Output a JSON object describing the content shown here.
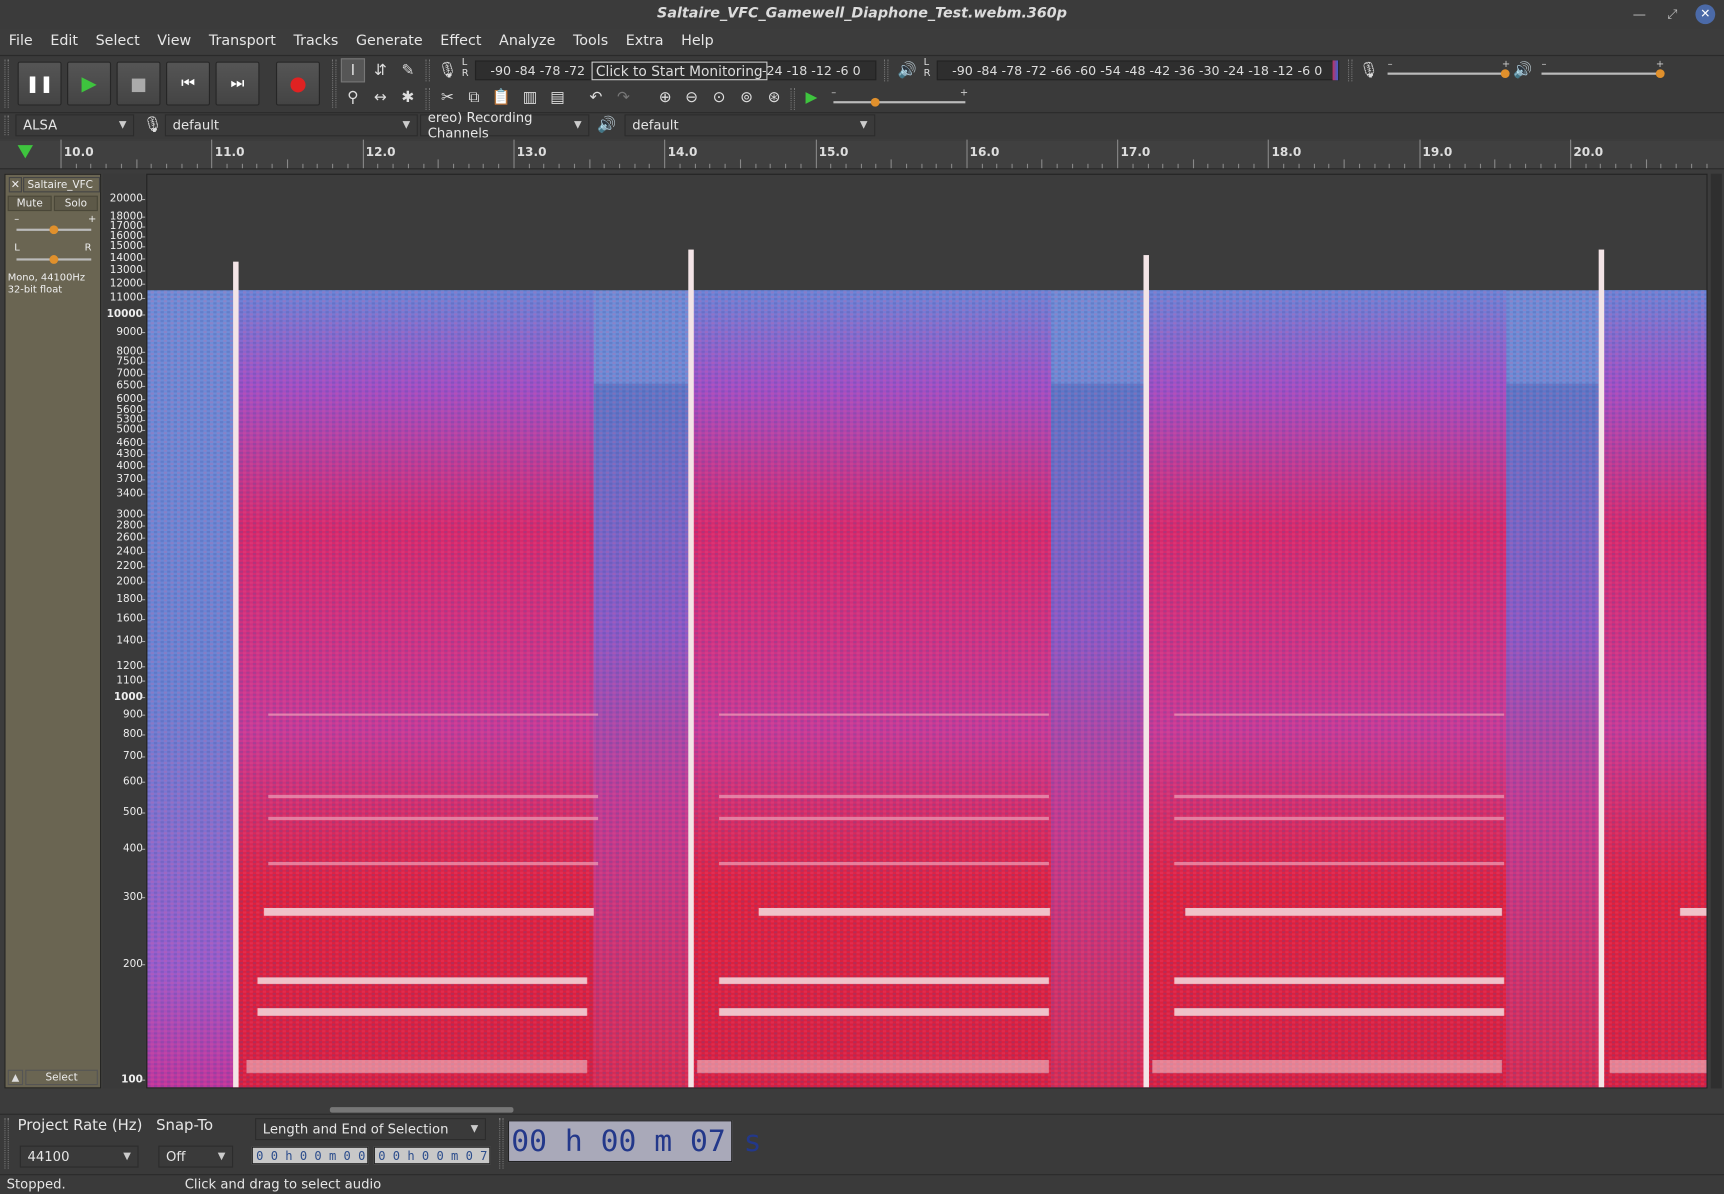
{
  "window": {
    "title": "Saltaire_VFC_Gamewell_Diaphone_Test.webm.360p"
  },
  "menu": [
    "File",
    "Edit",
    "Select",
    "View",
    "Transport",
    "Tracks",
    "Generate",
    "Effect",
    "Analyze",
    "Tools",
    "Extra",
    "Help"
  ],
  "meters": {
    "record_scale": "-90 -84 -78 -72",
    "record_tail": "-24 -18 -12  -6  0",
    "monitor_prompt": "Click to Start Monitoring",
    "playback_scale": "-90 -84 -78 -72 -66 -60 -54 -48 -42 -36 -30 -24 -18 -12  -6  0",
    "L": "L",
    "R": "R"
  },
  "devices": {
    "host": "ALSA",
    "recording_device": "default",
    "recording_channels": "ereo) Recording Channels",
    "playback_device": "default"
  },
  "ruler": {
    "labels": [
      "10.0",
      "11.0",
      "12.0",
      "13.0",
      "14.0",
      "15.0",
      "16.0",
      "17.0",
      "18.0",
      "19.0",
      "20.0"
    ]
  },
  "track": {
    "name": "Saltaire_VFC",
    "mute": "Mute",
    "solo": "Solo",
    "gain_minus": "–",
    "gain_plus": "+",
    "pan_left": "L",
    "pan_right": "R",
    "info_line1": "Mono, 44100Hz",
    "info_line2": "32-bit float",
    "select": "Select",
    "collapse": "▲",
    "close": "✕"
  },
  "freq_scale": [
    "20000",
    "18000",
    "17000",
    "16000",
    "15000",
    "14000",
    "13000",
    "12000",
    "11000",
    "10000",
    "9000",
    "8000",
    "7500",
    "7000",
    "6500",
    "6000",
    "5600",
    "5300",
    "5000",
    "4600",
    "4300",
    "4000",
    "3700",
    "3400",
    "3000",
    "2800",
    "2600",
    "2400",
    "2200",
    "2000",
    "1800",
    "1600",
    "1400",
    "1200",
    "1100",
    "1000",
    "900",
    "800",
    "700",
    "600",
    "500",
    "400",
    "300",
    "200",
    "100"
  ],
  "bottom": {
    "project_rate_label": "Project Rate (Hz)",
    "project_rate_value": "44100",
    "snap_label": "Snap-To",
    "snap_value": "Off",
    "selection_mode": "Length and End of Selection",
    "sel_start": "0 0 h 0 0 m 0 0 s",
    "sel_end": "0 0 h 0 0 m 0 7 s",
    "time_display": "00 h 00 m 07 s"
  },
  "status": {
    "state": "Stopped.",
    "hint": "Click and drag to select audio"
  },
  "colors": {
    "accent": "#e0902c",
    "spectro_low": "#5b7bd6",
    "spectro_mid": "#c2389a",
    "spectro_high": "#e01838",
    "spectro_peak": "#f3e4e6"
  }
}
